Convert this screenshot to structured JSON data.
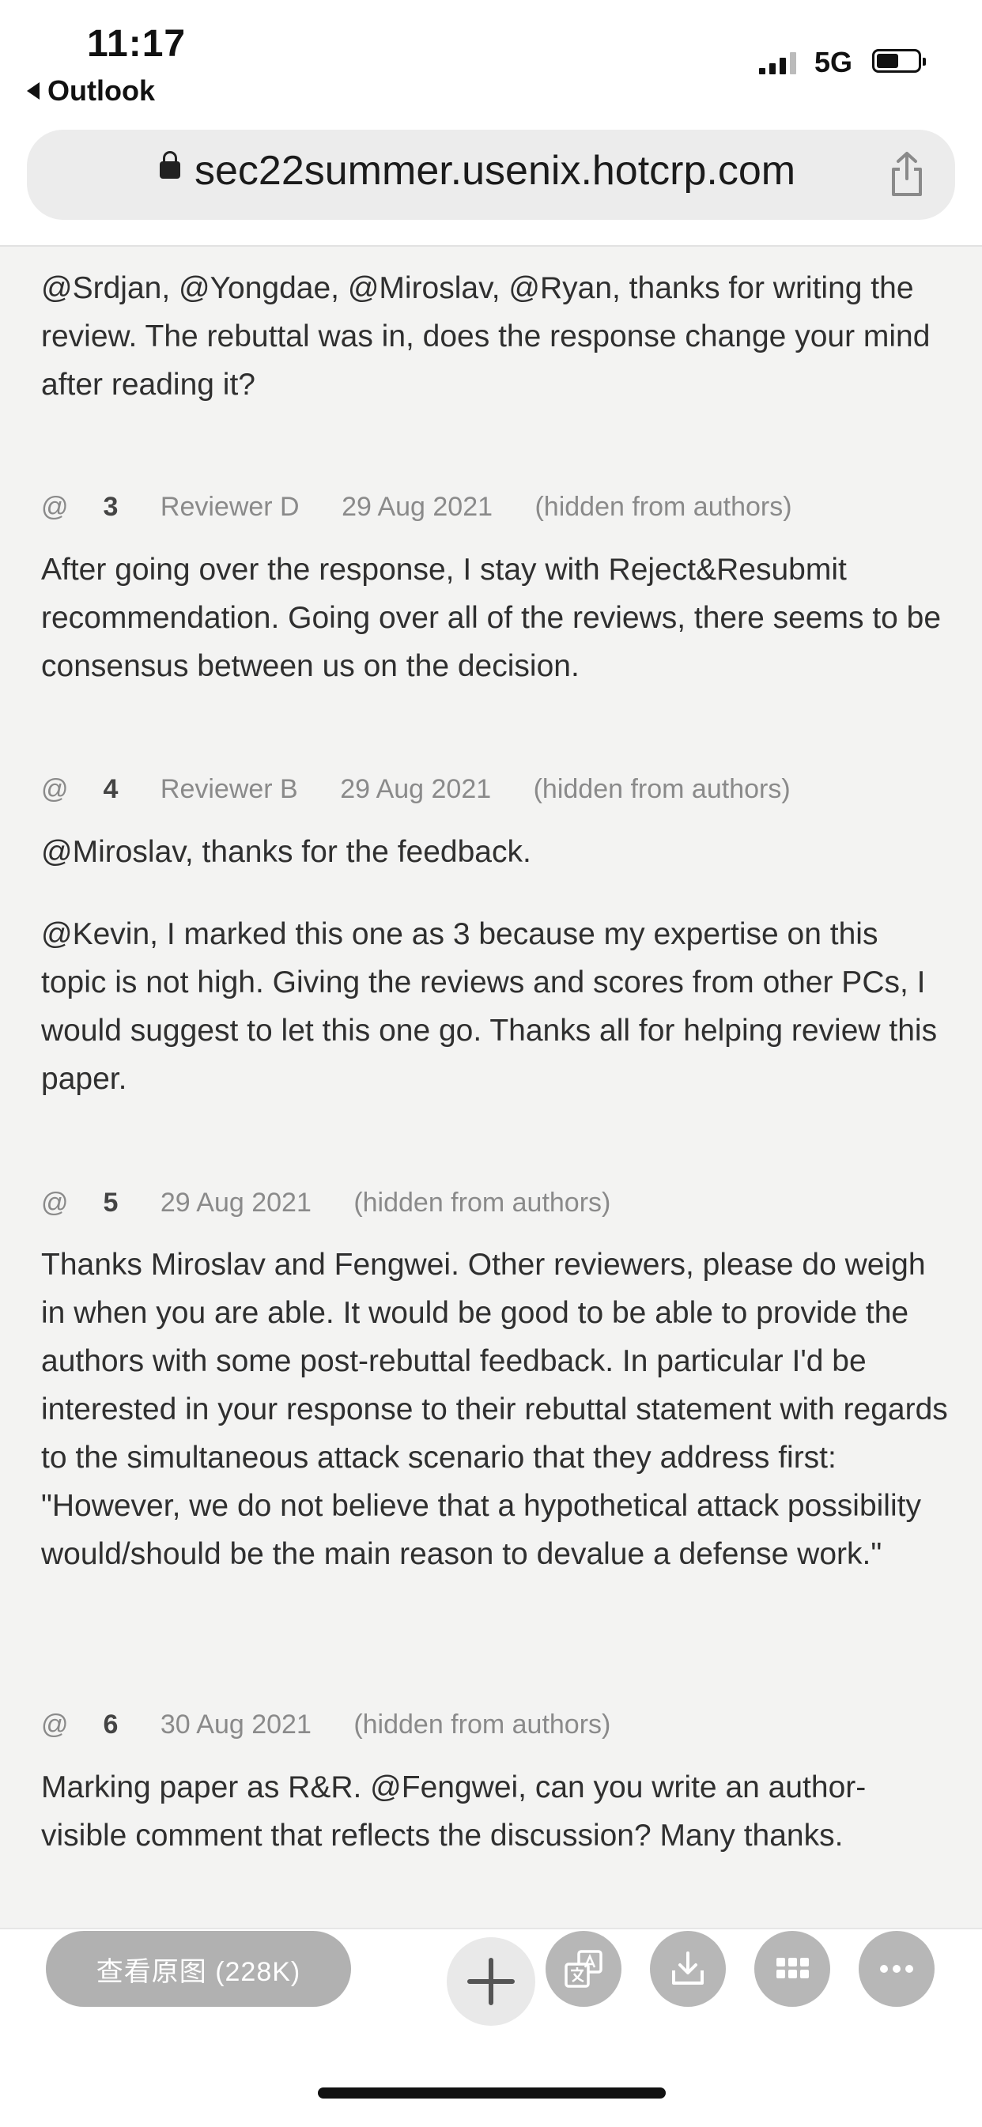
{
  "status_bar": {
    "time": "11:17",
    "back_app": "Outlook",
    "network": "5G",
    "battery_level": 0.55
  },
  "browser": {
    "url": "sec22summer.usenix.hotcrp.com"
  },
  "comments": [
    {
      "body": [
        "@Srdjan, @Yongdae, @Miroslav, @Ryan, thanks for writing the review. The rebuttal was in, does the response change your mind after reading it?"
      ]
    },
    {
      "prefix": "@",
      "number": "3",
      "reviewer": "Reviewer D",
      "date": "29 Aug 2021",
      "visibility": "(hidden from authors)",
      "body": [
        "After going over the response, I stay with Reject&Resubmit recommendation. Going over all of the reviews, there seems to be consensus between us on the decision."
      ]
    },
    {
      "prefix": "@",
      "number": "4",
      "reviewer": "Reviewer B",
      "date": "29 Aug 2021",
      "visibility": "(hidden from authors)",
      "body": [
        "@Miroslav, thanks for the feedback.",
        "@Kevin, I marked this one as 3 because my expertise on this topic is not high. Giving the reviews and scores from other PCs, I would suggest to let this one go. Thanks all for helping review this paper."
      ]
    },
    {
      "prefix": "@",
      "number": "5",
      "date": "29 Aug 2021",
      "visibility": "(hidden from authors)",
      "body": [
        "Thanks Miroslav and Fengwei. Other reviewers, please do weigh in when you are able. It would be good to be able to provide the authors with some post-rebuttal feedback. In particular I'd be interested in your response to their rebuttal statement with regards to the simultaneous attack scenario that they address first: \"However, we do not believe that a hypothetical attack possibility would/should be the main reason to devalue a defense work.\""
      ]
    },
    {
      "prefix": "@",
      "number": "6",
      "date": "30 Aug 2021",
      "visibility": "(hidden from authors)",
      "body": [
        "Marking paper as R&R. @Fengwei, can you write an author-visible comment that reflects the discussion? Many thanks."
      ]
    }
  ],
  "viewer_overlay": {
    "view_original_label": "查看原图 (228K)",
    "icons": [
      "plus-icon",
      "translate-icon",
      "download-icon",
      "grid-icon",
      "more-icon"
    ]
  }
}
